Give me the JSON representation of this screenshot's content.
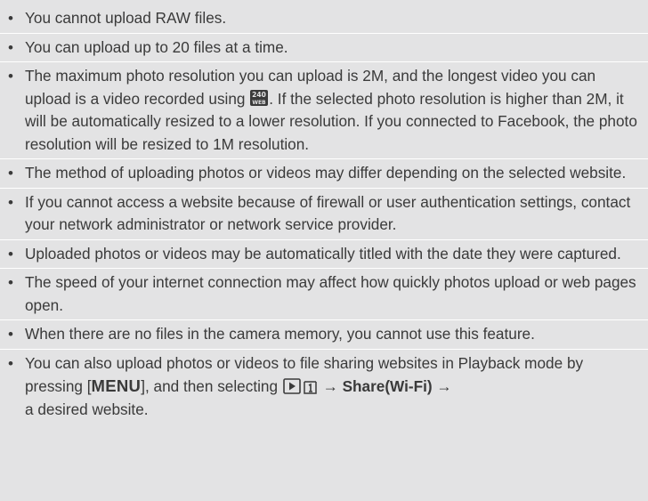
{
  "items": [
    {
      "text": "You cannot upload RAW files."
    },
    {
      "text": "You can upload up to 20 files at a time."
    },
    {
      "text_a": "The maximum photo resolution you can upload is 2M, and the longest video you can upload is a video recorded using ",
      "icon": "240-web-resolution-icon",
      "text_b": ". If the selected photo resolution is higher than 2M, it will be automatically resized to a lower resolution. If you connected to Facebook, the photo resolution will be resized to 1M resolution."
    },
    {
      "text": "The method of uploading photos or videos may differ depending on the selected website."
    },
    {
      "text": "If you cannot access a website because of firewall or user authentication settings, contact your network administrator or network service provider."
    },
    {
      "text": "Uploaded photos or videos may be automatically titled with the date they were captured."
    },
    {
      "text": "The speed of your internet connection may affect how quickly photos upload or web pages open."
    },
    {
      "text": "When there are no files in the camera memory, you cannot use this feature."
    },
    {
      "text_a": "You can also upload photos or videos to file sharing websites in Playback mode by pressing [",
      "menu_key": "MENU",
      "text_b": "], and then selecting ",
      "arrow1": " → ",
      "share_label": "Share(Wi-Fi)",
      "arrow2": " → ",
      "text_c": "a desired website."
    }
  ],
  "bullet": "•",
  "icons": {
    "resolution": "240-web-resolution-icon",
    "playback": "playback-icon",
    "menu1": "menu-page-1-icon"
  }
}
